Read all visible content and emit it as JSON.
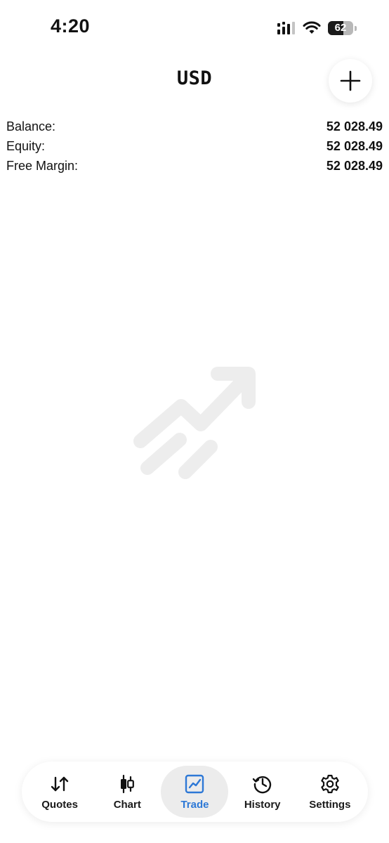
{
  "status_bar": {
    "time": "4:20",
    "battery": "62",
    "battery_level": 0.62
  },
  "header": {
    "title": "USD",
    "add_icon": "plus-icon"
  },
  "account": {
    "rows": [
      {
        "label": "Balance:",
        "value": "52 028.49"
      },
      {
        "label": "Equity:",
        "value": "52 028.49"
      },
      {
        "label": "Free Margin:",
        "value": "52 028.49"
      }
    ]
  },
  "empty_state": {
    "icon": "trending-up-icon"
  },
  "tab_bar": {
    "tabs": [
      {
        "label": "Quotes",
        "icon": "quotes-arrows-icon",
        "active": false
      },
      {
        "label": "Chart",
        "icon": "candlestick-icon",
        "active": false
      },
      {
        "label": "Trade",
        "icon": "trade-chart-icon",
        "active": true
      },
      {
        "label": "History",
        "icon": "history-clock-icon",
        "active": false
      },
      {
        "label": "Settings",
        "icon": "gear-icon",
        "active": false
      }
    ],
    "accent_color": "#2d78d6"
  }
}
